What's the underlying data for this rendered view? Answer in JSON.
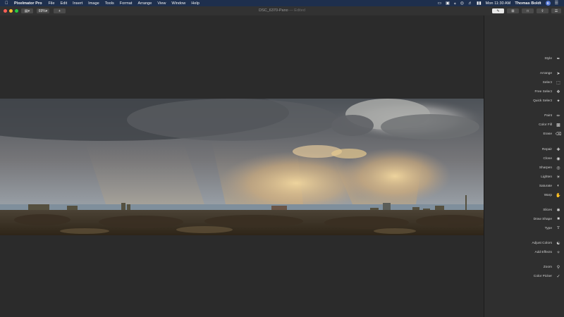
{
  "menubar": {
    "app_name": "Pixelmator Pro",
    "items": [
      "File",
      "Edit",
      "Insert",
      "Image",
      "Tools",
      "Format",
      "Arrange",
      "View",
      "Window",
      "Help"
    ],
    "time": "Mon 11:30 AM",
    "user": "Thomas Boldt",
    "user_initial": "B"
  },
  "toolbar": {
    "zoom_label": "69%",
    "add_label": "+",
    "doc_name": "DSC_6370-Pano",
    "doc_status": "— Edited"
  },
  "sidebar": {
    "tools": [
      {
        "label": "Style",
        "icon": "style-icon"
      },
      {
        "label": "Arrange",
        "icon": "arrange-icon"
      },
      {
        "label": "Select",
        "icon": "select-icon"
      },
      {
        "label": "Free Select",
        "icon": "free-select-icon"
      },
      {
        "label": "Quick Select",
        "icon": "quick-select-icon"
      },
      {
        "label": "Paint",
        "icon": "paint-icon"
      },
      {
        "label": "Color Fill",
        "icon": "color-fill-icon"
      },
      {
        "label": "Erase",
        "icon": "erase-icon"
      },
      {
        "label": "Repair",
        "icon": "repair-icon"
      },
      {
        "label": "Clone",
        "icon": "clone-icon"
      },
      {
        "label": "Sharpen",
        "icon": "sharpen-icon"
      },
      {
        "label": "Lighten",
        "icon": "lighten-icon"
      },
      {
        "label": "Saturate",
        "icon": "saturate-icon"
      },
      {
        "label": "Warp",
        "icon": "warp-icon"
      },
      {
        "label": "Slices",
        "icon": "slices-icon"
      },
      {
        "label": "Draw Shape",
        "icon": "draw-shape-icon"
      },
      {
        "label": "Type",
        "icon": "type-icon"
      },
      {
        "label": "Adjust Colors",
        "icon": "adjust-colors-icon"
      },
      {
        "label": "Add Effects",
        "icon": "add-effects-icon"
      },
      {
        "label": "Zoom",
        "icon": "zoom-icon"
      },
      {
        "label": "Color Picker",
        "icon": "color-picker-icon"
      }
    ]
  },
  "colors": {
    "menubar_bg": "#1e2f4d",
    "canvas_bg": "#2b2b2b",
    "sidebar_bg": "#2f2f2f"
  }
}
